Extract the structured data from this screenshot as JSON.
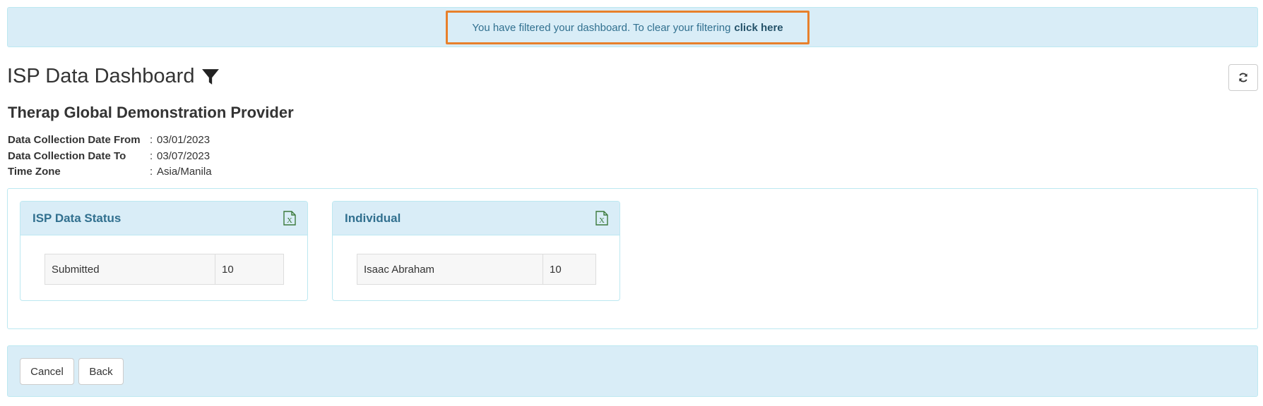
{
  "filter_notice": {
    "message": "You have filtered your dashboard. To clear your filtering",
    "link": "click here"
  },
  "header": {
    "title": "ISP Data Dashboard",
    "filter_icon": "filter-icon",
    "refresh_icon": "refresh-icon"
  },
  "provider": "Therap Global Demonstration Provider",
  "meta": [
    {
      "label": "Data Collection Date From",
      "sep": ":",
      "value": "03/01/2023"
    },
    {
      "label": "Data Collection Date To",
      "sep": ":",
      "value": "03/07/2023"
    },
    {
      "label": "Time Zone",
      "sep": ":",
      "value": "Asia/Manila"
    }
  ],
  "widgets": [
    {
      "title": "ISP Data Status",
      "icon": "excel-export-icon",
      "rows": [
        {
          "name": "Submitted",
          "count": "10"
        }
      ]
    },
    {
      "title": "Individual",
      "icon": "excel-export-icon",
      "rows": [
        {
          "name": "Isaac Abraham",
          "count": "10"
        }
      ]
    }
  ],
  "actions": {
    "cancel": "Cancel",
    "back": "Back"
  },
  "colors": {
    "info_bg": "#d9edf7",
    "info_border": "#bce8f1",
    "info_text": "#31708f",
    "highlight": "#e8802b",
    "excel_green": "#3c7a3c"
  }
}
